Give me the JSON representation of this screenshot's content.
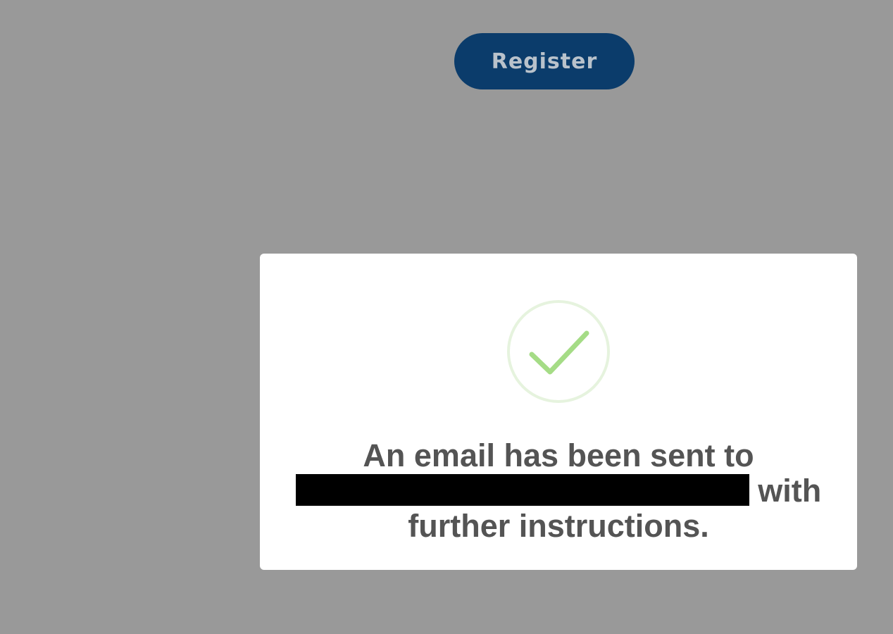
{
  "page": {
    "background_color": "#999999"
  },
  "header": {
    "register_label": "Register",
    "register_color": "#0b3c6b"
  },
  "modal": {
    "icon": "success-check-icon",
    "icon_color": "#a5dc86",
    "message_line1": "An email has been sent to",
    "message_after_email": "with",
    "message_line3": "further instructions."
  }
}
